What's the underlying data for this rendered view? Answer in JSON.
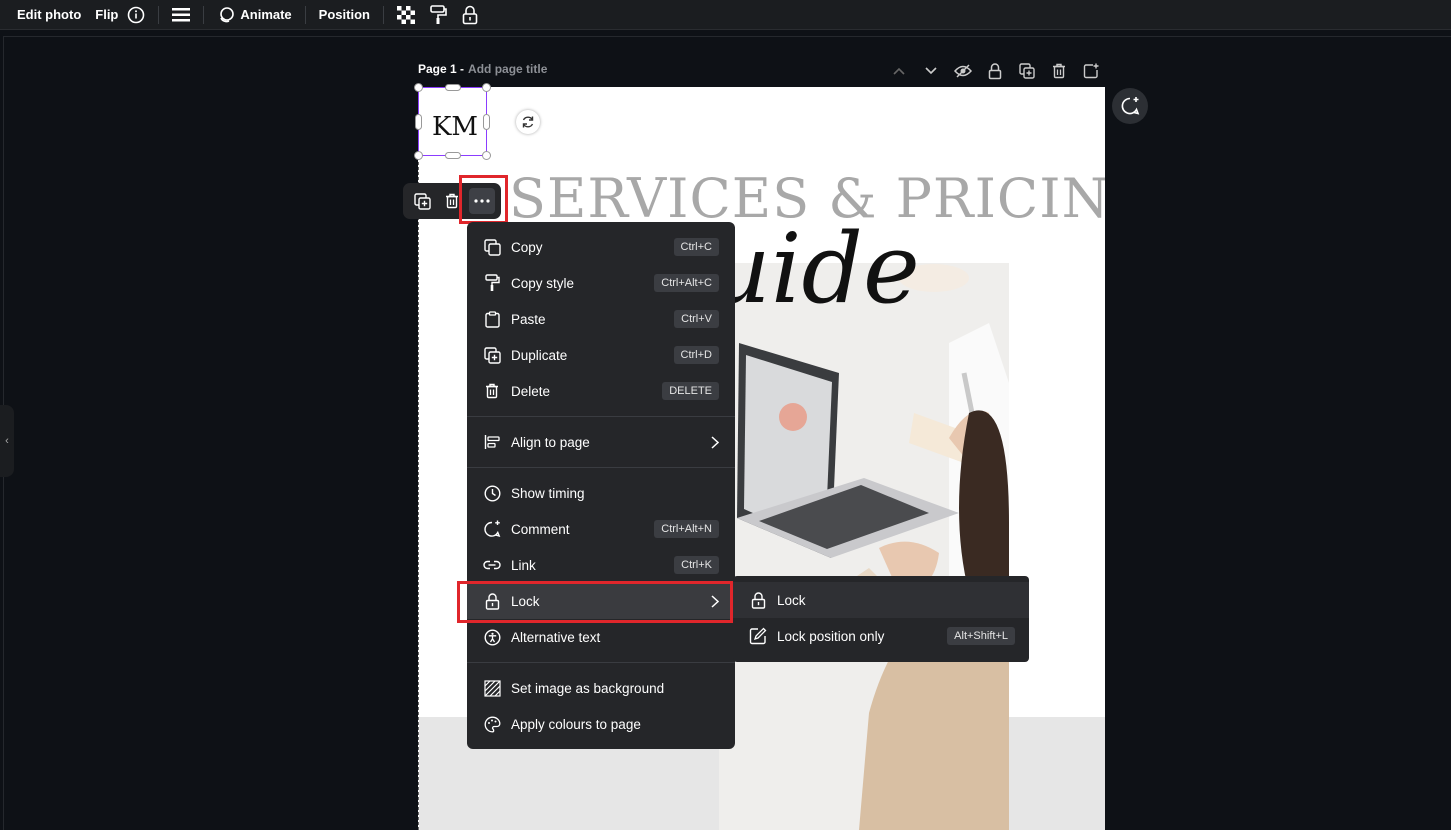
{
  "toolbar": {
    "edit_photo": "Edit photo",
    "flip": "Flip",
    "animate": "Animate",
    "position": "Position"
  },
  "page_header": {
    "page_name": "Page 1 -",
    "page_title_placeholder": "Add page title"
  },
  "canvas": {
    "heading": "SERVICES & PRICING",
    "script_text": "uide",
    "logo_text": "KM"
  },
  "context_menu": {
    "items": [
      {
        "label": "Copy",
        "shortcut": "Ctrl+C",
        "icon": "copy-icon"
      },
      {
        "label": "Copy style",
        "shortcut": "Ctrl+Alt+C",
        "icon": "paint-roller-icon"
      },
      {
        "label": "Paste",
        "shortcut": "Ctrl+V",
        "icon": "clipboard-icon"
      },
      {
        "label": "Duplicate",
        "shortcut": "Ctrl+D",
        "icon": "duplicate-icon"
      },
      {
        "label": "Delete",
        "shortcut": "DELETE",
        "icon": "trash-icon"
      },
      {
        "label": "Align to page",
        "icon": "align-icon"
      },
      {
        "label": "Show timing",
        "icon": "clock-icon"
      },
      {
        "label": "Comment",
        "shortcut": "Ctrl+Alt+N",
        "icon": "comment-icon"
      },
      {
        "label": "Link",
        "shortcut": "Ctrl+K",
        "icon": "link-icon"
      },
      {
        "label": "Lock",
        "icon": "lock-icon"
      },
      {
        "label": "Alternative text",
        "icon": "accessibility-icon"
      },
      {
        "label": "Set image as background",
        "icon": "background-icon"
      },
      {
        "label": "Apply colours to page",
        "icon": "palette-icon"
      }
    ]
  },
  "lock_submenu": {
    "items": [
      {
        "label": "Lock",
        "icon": "lock-icon"
      },
      {
        "label": "Lock position only",
        "shortcut": "Alt+Shift+L",
        "icon": "lock-position-icon"
      }
    ]
  },
  "colors": {
    "background": "#0e1116",
    "toolbar": "#1b1d20",
    "menu": "#252629",
    "highlight_red": "#e0262b",
    "selection_purple": "#8b3dff"
  }
}
